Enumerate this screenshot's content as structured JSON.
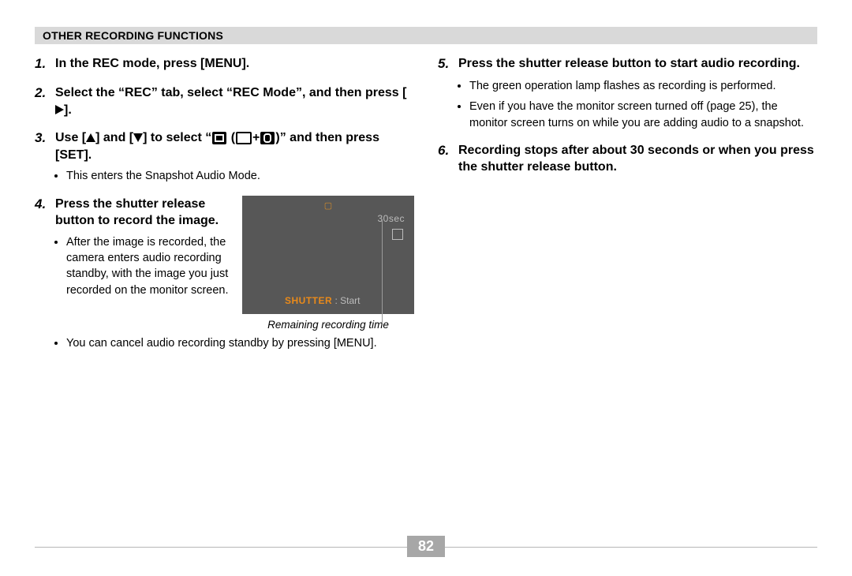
{
  "header": "OTHER RECORDING FUNCTIONS",
  "page_number": "82",
  "left": {
    "steps": [
      {
        "num": "1.",
        "text": "In the REC mode, press [MENU]."
      },
      {
        "num": "2.",
        "text_a": "Select the “REC” tab, select “REC Mode”, and then press [",
        "text_b": "]."
      },
      {
        "num": "3.",
        "text_a": "Use [",
        "text_b": "] and [",
        "text_c": "] to select  “",
        "text_d": " (",
        "text_e": "+",
        "text_f": ")” and then press [SET].",
        "bullets": [
          "This enters the Snapshot Audio Mode."
        ]
      },
      {
        "num": "4.",
        "text": "Press the shutter release button to record the image.",
        "bullets_a": [
          "After the image is recorded, the camera enters audio recording standby, with the image you just recorded on the monitor screen."
        ],
        "bullets_b": [
          "You can cancel audio recording standby by pressing [MENU]."
        ]
      }
    ],
    "lcd": {
      "time": "30sec",
      "shutter_label": "SHUTTER",
      "start_label": " : Start",
      "caption": "Remaining recording time"
    }
  },
  "right": {
    "steps": [
      {
        "num": "5.",
        "text": "Press the shutter release button to start audio recording.",
        "bullets": [
          "The green operation lamp flashes as recording is performed.",
          "Even if you have the monitor screen turned off (page 25), the monitor screen turns on while you are adding audio to a snapshot."
        ]
      },
      {
        "num": "6.",
        "text": "Recording stops after about 30 seconds or when you press the shutter release button."
      }
    ]
  }
}
